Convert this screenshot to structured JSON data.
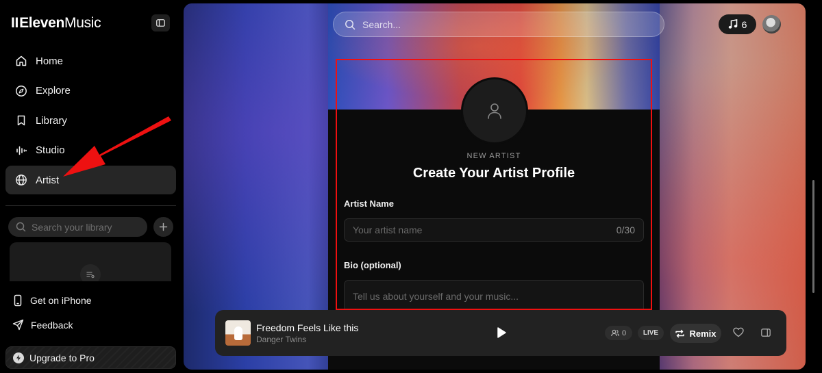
{
  "app": {
    "logo_bars": "II",
    "logo_bold": "Eleven",
    "logo_light": "Music"
  },
  "sidebar": {
    "nav": [
      {
        "label": "Home",
        "icon": "home-icon"
      },
      {
        "label": "Explore",
        "icon": "compass-icon"
      },
      {
        "label": "Library",
        "icon": "bookmark-icon"
      },
      {
        "label": "Studio",
        "icon": "waveform-icon"
      },
      {
        "label": "Artist",
        "icon": "globe-icon",
        "active": true
      }
    ],
    "library_search_placeholder": "Search your library",
    "get_on_iphone": "Get on iPhone",
    "feedback": "Feedback",
    "upgrade": "Upgrade to Pro"
  },
  "header": {
    "search_placeholder": "Search...",
    "credits": "6"
  },
  "form": {
    "eyebrow": "NEW ARTIST",
    "title": "Create Your Artist Profile",
    "artist_name_label": "Artist Name",
    "artist_name_placeholder": "Your artist name",
    "artist_name_counter": "0/30",
    "bio_label": "Bio (optional)",
    "bio_placeholder": "Tell us about yourself and your music..."
  },
  "player": {
    "track_title": "Freedom Feels Like this",
    "track_artist": "Danger Twins",
    "listeners": "0",
    "live": "LIVE",
    "remix": "Remix"
  },
  "colors": {
    "highlight": "#f01010",
    "active_nav_bg": "#262626",
    "player_bg": "#222222"
  }
}
